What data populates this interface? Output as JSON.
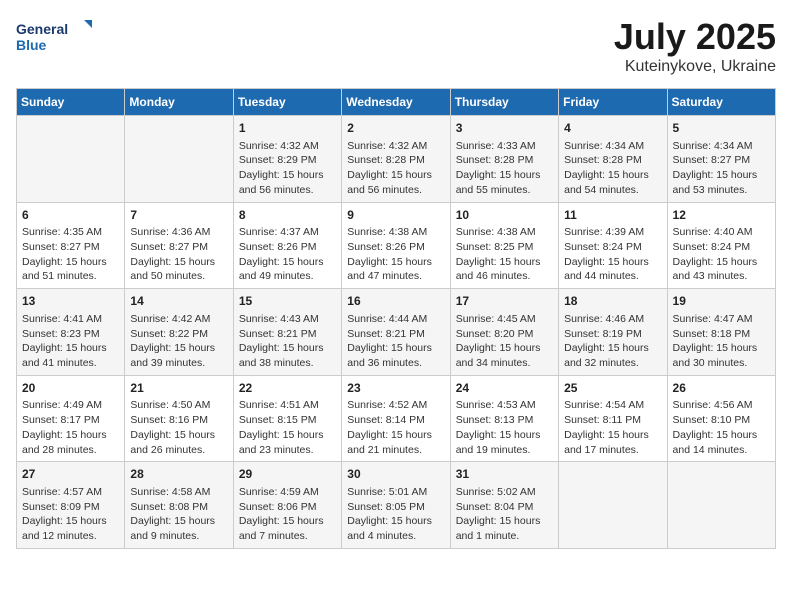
{
  "header": {
    "logo_line1": "General",
    "logo_line2": "Blue",
    "title": "July 2025",
    "subtitle": "Kuteinykove, Ukraine"
  },
  "columns": [
    "Sunday",
    "Monday",
    "Tuesday",
    "Wednesday",
    "Thursday",
    "Friday",
    "Saturday"
  ],
  "weeks": [
    [
      {
        "day": "",
        "info": ""
      },
      {
        "day": "",
        "info": ""
      },
      {
        "day": "1",
        "info": "Sunrise: 4:32 AM\nSunset: 8:29 PM\nDaylight: 15 hours and 56 minutes."
      },
      {
        "day": "2",
        "info": "Sunrise: 4:32 AM\nSunset: 8:28 PM\nDaylight: 15 hours and 56 minutes."
      },
      {
        "day": "3",
        "info": "Sunrise: 4:33 AM\nSunset: 8:28 PM\nDaylight: 15 hours and 55 minutes."
      },
      {
        "day": "4",
        "info": "Sunrise: 4:34 AM\nSunset: 8:28 PM\nDaylight: 15 hours and 54 minutes."
      },
      {
        "day": "5",
        "info": "Sunrise: 4:34 AM\nSunset: 8:27 PM\nDaylight: 15 hours and 53 minutes."
      }
    ],
    [
      {
        "day": "6",
        "info": "Sunrise: 4:35 AM\nSunset: 8:27 PM\nDaylight: 15 hours and 51 minutes."
      },
      {
        "day": "7",
        "info": "Sunrise: 4:36 AM\nSunset: 8:27 PM\nDaylight: 15 hours and 50 minutes."
      },
      {
        "day": "8",
        "info": "Sunrise: 4:37 AM\nSunset: 8:26 PM\nDaylight: 15 hours and 49 minutes."
      },
      {
        "day": "9",
        "info": "Sunrise: 4:38 AM\nSunset: 8:26 PM\nDaylight: 15 hours and 47 minutes."
      },
      {
        "day": "10",
        "info": "Sunrise: 4:38 AM\nSunset: 8:25 PM\nDaylight: 15 hours and 46 minutes."
      },
      {
        "day": "11",
        "info": "Sunrise: 4:39 AM\nSunset: 8:24 PM\nDaylight: 15 hours and 44 minutes."
      },
      {
        "day": "12",
        "info": "Sunrise: 4:40 AM\nSunset: 8:24 PM\nDaylight: 15 hours and 43 minutes."
      }
    ],
    [
      {
        "day": "13",
        "info": "Sunrise: 4:41 AM\nSunset: 8:23 PM\nDaylight: 15 hours and 41 minutes."
      },
      {
        "day": "14",
        "info": "Sunrise: 4:42 AM\nSunset: 8:22 PM\nDaylight: 15 hours and 39 minutes."
      },
      {
        "day": "15",
        "info": "Sunrise: 4:43 AM\nSunset: 8:21 PM\nDaylight: 15 hours and 38 minutes."
      },
      {
        "day": "16",
        "info": "Sunrise: 4:44 AM\nSunset: 8:21 PM\nDaylight: 15 hours and 36 minutes."
      },
      {
        "day": "17",
        "info": "Sunrise: 4:45 AM\nSunset: 8:20 PM\nDaylight: 15 hours and 34 minutes."
      },
      {
        "day": "18",
        "info": "Sunrise: 4:46 AM\nSunset: 8:19 PM\nDaylight: 15 hours and 32 minutes."
      },
      {
        "day": "19",
        "info": "Sunrise: 4:47 AM\nSunset: 8:18 PM\nDaylight: 15 hours and 30 minutes."
      }
    ],
    [
      {
        "day": "20",
        "info": "Sunrise: 4:49 AM\nSunset: 8:17 PM\nDaylight: 15 hours and 28 minutes."
      },
      {
        "day": "21",
        "info": "Sunrise: 4:50 AM\nSunset: 8:16 PM\nDaylight: 15 hours and 26 minutes."
      },
      {
        "day": "22",
        "info": "Sunrise: 4:51 AM\nSunset: 8:15 PM\nDaylight: 15 hours and 23 minutes."
      },
      {
        "day": "23",
        "info": "Sunrise: 4:52 AM\nSunset: 8:14 PM\nDaylight: 15 hours and 21 minutes."
      },
      {
        "day": "24",
        "info": "Sunrise: 4:53 AM\nSunset: 8:13 PM\nDaylight: 15 hours and 19 minutes."
      },
      {
        "day": "25",
        "info": "Sunrise: 4:54 AM\nSunset: 8:11 PM\nDaylight: 15 hours and 17 minutes."
      },
      {
        "day": "26",
        "info": "Sunrise: 4:56 AM\nSunset: 8:10 PM\nDaylight: 15 hours and 14 minutes."
      }
    ],
    [
      {
        "day": "27",
        "info": "Sunrise: 4:57 AM\nSunset: 8:09 PM\nDaylight: 15 hours and 12 minutes."
      },
      {
        "day": "28",
        "info": "Sunrise: 4:58 AM\nSunset: 8:08 PM\nDaylight: 15 hours and 9 minutes."
      },
      {
        "day": "29",
        "info": "Sunrise: 4:59 AM\nSunset: 8:06 PM\nDaylight: 15 hours and 7 minutes."
      },
      {
        "day": "30",
        "info": "Sunrise: 5:01 AM\nSunset: 8:05 PM\nDaylight: 15 hours and 4 minutes."
      },
      {
        "day": "31",
        "info": "Sunrise: 5:02 AM\nSunset: 8:04 PM\nDaylight: 15 hours and 1 minute."
      },
      {
        "day": "",
        "info": ""
      },
      {
        "day": "",
        "info": ""
      }
    ]
  ]
}
